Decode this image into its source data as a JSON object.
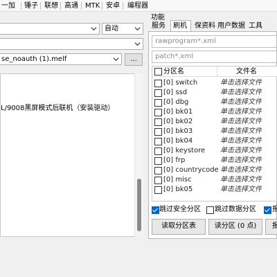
{
  "menubar": {
    "items": [
      "一加",
      "锤子",
      "联想",
      "高通",
      "MTK",
      "安卓",
      "编程器"
    ]
  },
  "left": {
    "combo1": {
      "value": ""
    },
    "combo_mode": {
      "value": "自动"
    },
    "combo2": {
      "value": ""
    },
    "loader": {
      "value": "se_noauth (1).melf"
    },
    "browse_label": "...",
    "log_text": "L/9008黑屏模式后联机（安装驱动）"
  },
  "right": {
    "section_label": "功能",
    "tabs": [
      "服务",
      "刷机",
      "保资料",
      "用户数据",
      "工具"
    ],
    "active_tab": "刷机",
    "rawprogram_placeholder": "rawprogram*.xml",
    "patch_placeholder": "patch*.xml",
    "grid": {
      "col_name": "分区名",
      "col_file": "文件名",
      "rows": [
        {
          "name": "[0] switch",
          "file": "单击选择文件"
        },
        {
          "name": "[0] ssd",
          "file": "单击选择文件"
        },
        {
          "name": "[0] dbg",
          "file": "单击选择文件"
        },
        {
          "name": "[0] bk01",
          "file": "单击选择文件"
        },
        {
          "name": "[0] bk02",
          "file": "单击选择文件"
        },
        {
          "name": "[0] bk03",
          "file": "单击选择文件"
        },
        {
          "name": "[0] bk04",
          "file": "单击选择文件"
        },
        {
          "name": "[0] keystore",
          "file": "单击选择文件"
        },
        {
          "name": "[0] frp",
          "file": "单击选择文件"
        },
        {
          "name": "[0] countrycode",
          "file": "单击选择文件"
        },
        {
          "name": "[0] misc",
          "file": "单击选择文件"
        },
        {
          "name": "[0] bk05",
          "file": "单击选择文件"
        }
      ]
    },
    "options": {
      "skip_safe": "跳过安全分区",
      "skip_data": "跳过数据分区",
      "third": "报"
    },
    "buttons": {
      "read_table": "读取分区表",
      "read_partition": "读分区 (0 点)",
      "third": "报"
    }
  },
  "colors": {
    "accent": "#0066cc"
  }
}
